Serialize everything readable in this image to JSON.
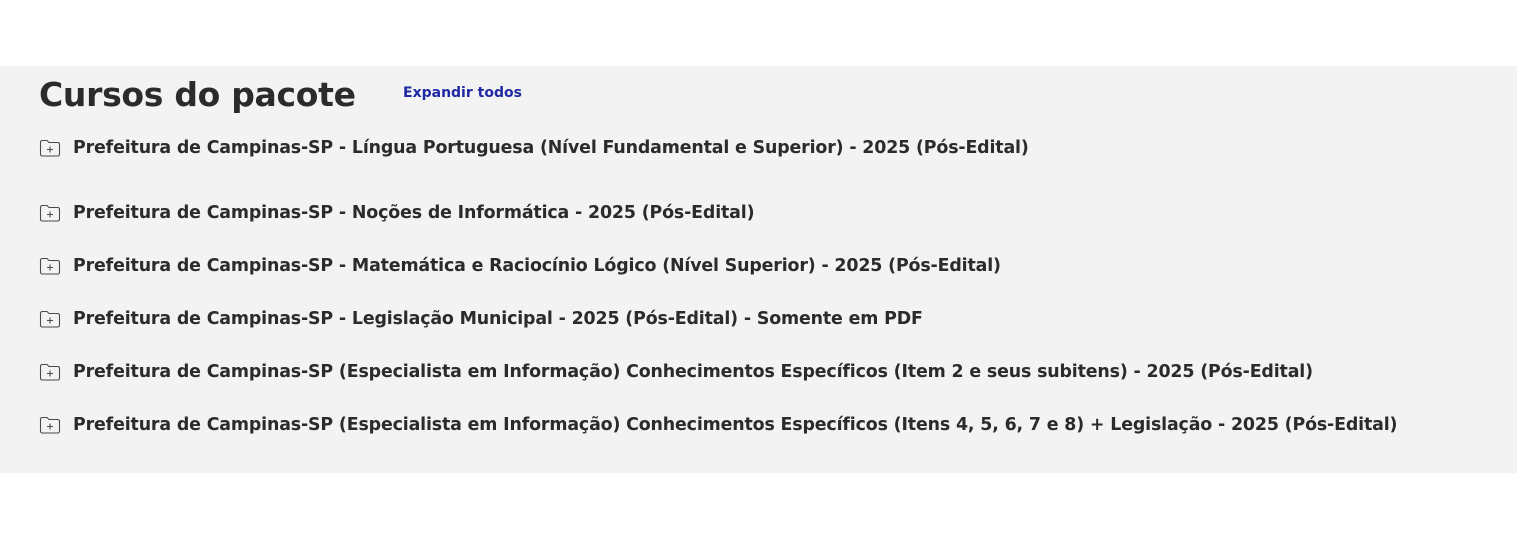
{
  "section": {
    "title": "Cursos do pacote",
    "expand_all_label": "Expandir todos"
  },
  "courses": [
    {
      "title": "Prefeitura de Campinas-SP - Língua Portuguesa (Nível Fundamental e Superior) - 2025 (Pós-Edital)",
      "icon": "folder-plus-icon"
    },
    {
      "title": "Prefeitura de Campinas-SP - Noções de Informática - 2025 (Pós-Edital)",
      "icon": "folder-plus-icon"
    },
    {
      "title": "Prefeitura de Campinas-SP - Matemática e Raciocínio Lógico (Nível Superior) - 2025 (Pós-Edital)",
      "icon": "folder-plus-icon"
    },
    {
      "title": "Prefeitura de Campinas-SP - Legislação Municipal - 2025 (Pós-Edital) - Somente em PDF",
      "icon": "folder-plus-icon"
    },
    {
      "title": "Prefeitura de Campinas-SP (Especialista em Informação) Conhecimentos Específicos (Item 2 e seus subitens) - 2025 (Pós-Edital)",
      "icon": "folder-plus-icon"
    },
    {
      "title": "Prefeitura de Campinas-SP (Especialista em Informação) Conhecimentos Específicos (Itens 4, 5, 6, 7 e 8) + Legislação - 2025 (Pós-Edital)",
      "icon": "folder-plus-icon"
    }
  ],
  "colors": {
    "section_background": "#f3f3f3",
    "text": "#2b2b2b",
    "link": "#1f29a3"
  }
}
